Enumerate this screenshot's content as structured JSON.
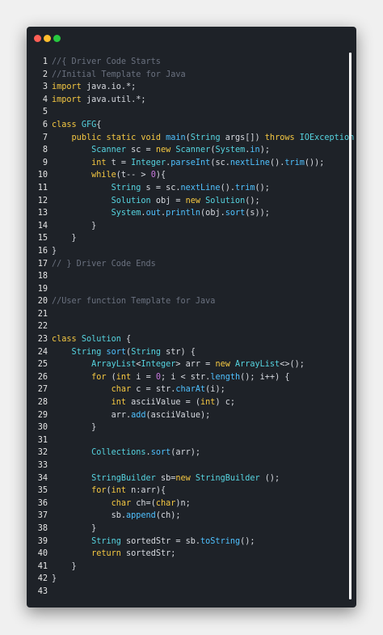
{
  "window": {
    "lines": [
      {
        "n": "1",
        "t": [
          [
            "cm",
            "//{ Driver Code Starts"
          ]
        ]
      },
      {
        "n": "2",
        "t": [
          [
            "cm",
            "//Initial Template for Java"
          ]
        ]
      },
      {
        "n": "3",
        "t": [
          [
            "kw",
            "import"
          ],
          [
            "pl",
            " java.io.*;"
          ]
        ]
      },
      {
        "n": "4",
        "t": [
          [
            "kw",
            "import"
          ],
          [
            "pl",
            " java.util.*;"
          ]
        ]
      },
      {
        "n": "5",
        "t": []
      },
      {
        "n": "6",
        "t": [
          [
            "kw",
            "class"
          ],
          [
            "pl",
            " "
          ],
          [
            "tp",
            "GFG"
          ],
          [
            "pl",
            "{"
          ]
        ]
      },
      {
        "n": "7",
        "t": [
          [
            "pl",
            "    "
          ],
          [
            "kw",
            "public static void"
          ],
          [
            "pl",
            " "
          ],
          [
            "fn",
            "main"
          ],
          [
            "pl",
            "("
          ],
          [
            "tp",
            "String"
          ],
          [
            "pl",
            " args[]) "
          ],
          [
            "kw",
            "throws"
          ],
          [
            "pl",
            " "
          ],
          [
            "tp",
            "IOException"
          ],
          [
            "pl",
            " {"
          ]
        ]
      },
      {
        "n": "8",
        "t": [
          [
            "pl",
            "        "
          ],
          [
            "tp",
            "Scanner"
          ],
          [
            "pl",
            " sc = "
          ],
          [
            "kw",
            "new"
          ],
          [
            "pl",
            " "
          ],
          [
            "tp",
            "Scanner"
          ],
          [
            "pl",
            "("
          ],
          [
            "tp",
            "System"
          ],
          [
            "pl",
            "."
          ],
          [
            "fn",
            "in"
          ],
          [
            "pl",
            ");"
          ]
        ]
      },
      {
        "n": "9",
        "t": [
          [
            "pl",
            "        "
          ],
          [
            "kw",
            "int"
          ],
          [
            "pl",
            " t = "
          ],
          [
            "tp",
            "Integer"
          ],
          [
            "pl",
            "."
          ],
          [
            "fn",
            "parseInt"
          ],
          [
            "pl",
            "(sc."
          ],
          [
            "fn",
            "nextLine"
          ],
          [
            "pl",
            "()."
          ],
          [
            "fn",
            "trim"
          ],
          [
            "pl",
            "());"
          ]
        ]
      },
      {
        "n": "10",
        "t": [
          [
            "pl",
            "        "
          ],
          [
            "kw",
            "while"
          ],
          [
            "pl",
            "(t-- > "
          ],
          [
            "num",
            "0"
          ],
          [
            "pl",
            "){"
          ]
        ]
      },
      {
        "n": "11",
        "t": [
          [
            "pl",
            "            "
          ],
          [
            "tp",
            "String"
          ],
          [
            "pl",
            " s = sc."
          ],
          [
            "fn",
            "nextLine"
          ],
          [
            "pl",
            "()."
          ],
          [
            "fn",
            "trim"
          ],
          [
            "pl",
            "();"
          ]
        ]
      },
      {
        "n": "12",
        "t": [
          [
            "pl",
            "            "
          ],
          [
            "tp",
            "Solution"
          ],
          [
            "pl",
            " obj = "
          ],
          [
            "kw",
            "new"
          ],
          [
            "pl",
            " "
          ],
          [
            "tp",
            "Solution"
          ],
          [
            "pl",
            "();"
          ]
        ]
      },
      {
        "n": "13",
        "t": [
          [
            "pl",
            "            "
          ],
          [
            "tp",
            "System"
          ],
          [
            "pl",
            "."
          ],
          [
            "fn",
            "out"
          ],
          [
            "pl",
            "."
          ],
          [
            "fn",
            "println"
          ],
          [
            "pl",
            "(obj."
          ],
          [
            "fn",
            "sort"
          ],
          [
            "pl",
            "(s));"
          ]
        ]
      },
      {
        "n": "14",
        "t": [
          [
            "pl",
            "        }"
          ]
        ]
      },
      {
        "n": "15",
        "t": [
          [
            "pl",
            "    }"
          ]
        ]
      },
      {
        "n": "16",
        "t": [
          [
            "pl",
            "}"
          ]
        ]
      },
      {
        "n": "17",
        "t": [
          [
            "cm",
            "// } Driver Code Ends"
          ]
        ]
      },
      {
        "n": "18",
        "t": []
      },
      {
        "n": "19",
        "t": []
      },
      {
        "n": "20",
        "t": [
          [
            "cm",
            "//User function Template for Java"
          ]
        ]
      },
      {
        "n": "21",
        "t": []
      },
      {
        "n": "22",
        "t": []
      },
      {
        "n": "23",
        "t": [
          [
            "kw",
            "class"
          ],
          [
            "pl",
            " "
          ],
          [
            "tp",
            "Solution"
          ],
          [
            "pl",
            " {"
          ]
        ]
      },
      {
        "n": "24",
        "t": [
          [
            "pl",
            "    "
          ],
          [
            "tp",
            "String"
          ],
          [
            "pl",
            " "
          ],
          [
            "fn",
            "sort"
          ],
          [
            "pl",
            "("
          ],
          [
            "tp",
            "String"
          ],
          [
            "pl",
            " str) {"
          ]
        ]
      },
      {
        "n": "25",
        "t": [
          [
            "pl",
            "        "
          ],
          [
            "tp",
            "ArrayList"
          ],
          [
            "pl",
            "<"
          ],
          [
            "tp",
            "Integer"
          ],
          [
            "pl",
            "> arr = "
          ],
          [
            "kw",
            "new"
          ],
          [
            "pl",
            " "
          ],
          [
            "tp",
            "ArrayList"
          ],
          [
            "pl",
            "<>();"
          ]
        ]
      },
      {
        "n": "26",
        "t": [
          [
            "pl",
            "        "
          ],
          [
            "kw",
            "for"
          ],
          [
            "pl",
            " ("
          ],
          [
            "kw",
            "int"
          ],
          [
            "pl",
            " i = "
          ],
          [
            "num",
            "0"
          ],
          [
            "pl",
            "; i < str."
          ],
          [
            "fn",
            "length"
          ],
          [
            "pl",
            "(); i++) {"
          ]
        ]
      },
      {
        "n": "27",
        "t": [
          [
            "pl",
            "            "
          ],
          [
            "kw",
            "char"
          ],
          [
            "pl",
            " c = str."
          ],
          [
            "fn",
            "charAt"
          ],
          [
            "pl",
            "(i);"
          ]
        ]
      },
      {
        "n": "28",
        "t": [
          [
            "pl",
            "            "
          ],
          [
            "kw",
            "int"
          ],
          [
            "pl",
            " asciiValue = ("
          ],
          [
            "kw",
            "int"
          ],
          [
            "pl",
            ") c;"
          ]
        ]
      },
      {
        "n": "29",
        "t": [
          [
            "pl",
            "            arr."
          ],
          [
            "fn",
            "add"
          ],
          [
            "pl",
            "(asciiValue);"
          ]
        ]
      },
      {
        "n": "30",
        "t": [
          [
            "pl",
            "        }"
          ]
        ]
      },
      {
        "n": "31",
        "t": []
      },
      {
        "n": "32",
        "t": [
          [
            "pl",
            "        "
          ],
          [
            "tp",
            "Collections"
          ],
          [
            "pl",
            "."
          ],
          [
            "fn",
            "sort"
          ],
          [
            "pl",
            "(arr);"
          ]
        ]
      },
      {
        "n": "33",
        "t": []
      },
      {
        "n": "34",
        "t": [
          [
            "pl",
            "        "
          ],
          [
            "tp",
            "StringBuilder"
          ],
          [
            "pl",
            " sb="
          ],
          [
            "kw",
            "new"
          ],
          [
            "pl",
            " "
          ],
          [
            "tp",
            "StringBuilder"
          ],
          [
            "pl",
            " ();"
          ]
        ]
      },
      {
        "n": "35",
        "t": [
          [
            "pl",
            "        "
          ],
          [
            "kw",
            "for"
          ],
          [
            "pl",
            "("
          ],
          [
            "kw",
            "int"
          ],
          [
            "pl",
            " n:arr){"
          ]
        ]
      },
      {
        "n": "36",
        "t": [
          [
            "pl",
            "            "
          ],
          [
            "kw",
            "char"
          ],
          [
            "pl",
            " ch=("
          ],
          [
            "kw",
            "char"
          ],
          [
            "pl",
            ")n;"
          ]
        ]
      },
      {
        "n": "37",
        "t": [
          [
            "pl",
            "            sb."
          ],
          [
            "fn",
            "append"
          ],
          [
            "pl",
            "(ch);"
          ]
        ]
      },
      {
        "n": "38",
        "t": [
          [
            "pl",
            "        }"
          ]
        ]
      },
      {
        "n": "39",
        "t": [
          [
            "pl",
            "        "
          ],
          [
            "tp",
            "String"
          ],
          [
            "pl",
            " sortedStr = sb."
          ],
          [
            "fn",
            "toString"
          ],
          [
            "pl",
            "();"
          ]
        ]
      },
      {
        "n": "40",
        "t": [
          [
            "pl",
            "        "
          ],
          [
            "kw",
            "return"
          ],
          [
            "pl",
            " sortedStr;"
          ]
        ]
      },
      {
        "n": "41",
        "t": [
          [
            "pl",
            "    }"
          ]
        ]
      },
      {
        "n": "42",
        "t": [
          [
            "pl",
            "}"
          ]
        ]
      },
      {
        "n": "43",
        "t": []
      }
    ]
  },
  "colors": {
    "background": "#1e2228",
    "keyword": "#f5c842",
    "type": "#56d4e0",
    "function": "#4fc1ff",
    "comment": "#6b7280",
    "number": "#c678dd",
    "plain": "#d7dae0"
  }
}
